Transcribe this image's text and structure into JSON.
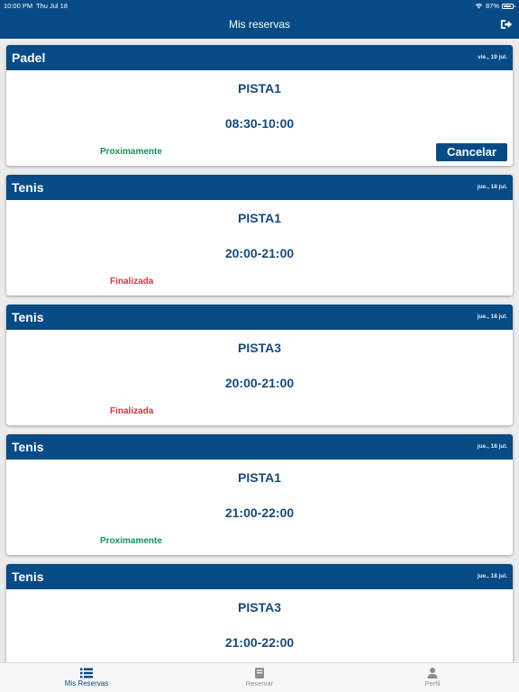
{
  "status_bar": {
    "time": "10:00 PM",
    "date": "Thu Jul 18",
    "battery": "87%",
    "battery_level": 0.87
  },
  "header": {
    "title": "Mis reservas",
    "logout_icon": "logout-icon"
  },
  "reservations": [
    {
      "sport": "Padel",
      "date": "vie., 19 jul.",
      "court": "PISTA1",
      "time": "08:30-10:00",
      "status": "Proximamente",
      "action": "Cancelar"
    },
    {
      "sport": "Tenis",
      "date": "jue., 18 jul.",
      "court": "PISTA1",
      "time": "20:00-21:00",
      "status": "Finalizada"
    },
    {
      "sport": "Tenis",
      "date": "jue., 18 jul.",
      "court": "PISTA3",
      "time": "20:00-21:00",
      "status": "Finalizada"
    },
    {
      "sport": "Tenis",
      "date": "jue., 18 jul.",
      "court": "PISTA1",
      "time": "21:00-22:00",
      "status": "Proximamente"
    },
    {
      "sport": "Tenis",
      "date": "jue., 18 jul.",
      "court": "PISTA3",
      "time": "21:00-22:00"
    }
  ],
  "tabs": [
    {
      "label": "Mis Reservas",
      "icon": "list-icon",
      "active": true
    },
    {
      "label": "Reservar",
      "icon": "book-icon",
      "active": false
    },
    {
      "label": "Perfil",
      "icon": "person-icon",
      "active": false
    }
  ],
  "colors": {
    "primary": "#064b85",
    "upcoming": "#1a8f5a",
    "finished": "#d7333d",
    "background": "#ececec"
  }
}
